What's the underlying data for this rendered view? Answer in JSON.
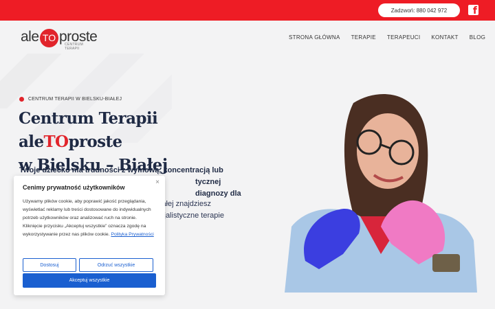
{
  "topbar": {
    "call": "Zadzwoń: 880 042 972",
    "facebook_glyph": "f"
  },
  "logo": {
    "part1": "ale",
    "part2": "TO",
    "part3": "proste",
    "sub": "CENTRUM TERAPII"
  },
  "nav": [
    "STRONA GŁÓWNA",
    "TERAPIE",
    "TERAPEUCI",
    "KONTAKT",
    "BLOG"
  ],
  "hero": {
    "tag": "CENTRUM TERAPII W BIELSKU-BIAŁEJ",
    "title_a": "Centrum Terapii ale",
    "title_b": "TO",
    "title_c": "proste",
    "title_d": "w Bielsku – Białej",
    "lead_1": "Twoje dziecko ma trudności z wymową, koncentracją lub",
    "lead_2": "tycznej diagnozy dla",
    "lead_3": "iałej znajdziesz",
    "lead_4": "cjalistyczne terapie"
  },
  "cookie": {
    "title": "Cenimy prywatność użytkowników",
    "close": "×",
    "text": "Używamy plików cookie, aby poprawić jakość przeglądania, wyświetlać reklamy lub treści dostosowane do indywidualnych potrzeb użytkowników oraz analizować ruch na stronie. Kliknięcie przycisku „Akceptuj wszystkie” oznacza zgodę na wykorzystywanie przez nas plików cookie.",
    "link": "Polityka Prywatności",
    "customize": "Dostosuj",
    "reject": "Odrzuć wszystkie",
    "accept": "Akceptuj wszystkie"
  },
  "colors": {
    "brand_red": "#ee1c25",
    "accent_blue": "#1a5fd0",
    "navy": "#1f2a44"
  }
}
